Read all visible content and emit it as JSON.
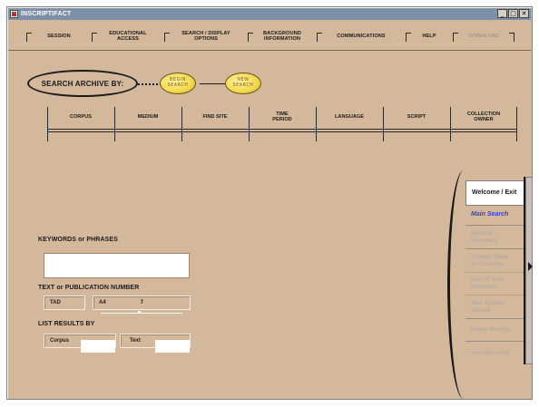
{
  "window": {
    "title": "INSCRIPTIFACT",
    "controls": [
      "_",
      "□",
      "✕"
    ]
  },
  "menu": [
    {
      "label": "SESSION",
      "enabled": true
    },
    {
      "label": "EDUCATIONAL\nACCESS",
      "enabled": true
    },
    {
      "label": "SEARCH / DISPLAY\nOPTIONS",
      "enabled": true
    },
    {
      "label": "BACKGROUND\nINFORMATION",
      "enabled": true
    },
    {
      "label": "COMMUNICATIONS",
      "enabled": true
    },
    {
      "label": "HELP",
      "enabled": true
    },
    {
      "label": "DOWNLOAD",
      "enabled": false
    }
  ],
  "search": {
    "archive_label": "SEARCH ARCHIVE BY:",
    "begin_button": "BEGIN\nSEARCH",
    "new_button": "NEW\nSEARCH"
  },
  "categories": [
    "CORPUS",
    "MEDIUM",
    "FIND SITE",
    "TIME\nPERIOD",
    "LANGUAGE",
    "SCRIPT",
    "COLLECTION\nOWNER"
  ],
  "keywords": {
    "label": "KEYWORDS or PHRASES",
    "value": ""
  },
  "publication": {
    "label": "TEXT or PUBLICATION NUMBER",
    "prefix": "TAD",
    "field_a": "A4",
    "field_b": "7"
  },
  "list_results": {
    "label": "LIST RESULTS BY",
    "corpus": "Corpus",
    "text": "Text"
  },
  "nav": [
    {
      "label": "Welcome / Exit",
      "state": "active"
    },
    {
      "label": "Main Search",
      "state": "current"
    },
    {
      "label": "Results\nSummary",
      "state": "disabled"
    },
    {
      "label": "Corpus Table\nof Contents",
      "state": "disabled"
    },
    {
      "label": "List Of Text\nDivisions",
      "state": "disabled"
    },
    {
      "label": "Text Spatial\nSearch",
      "state": "disabled"
    },
    {
      "label": "Image Results",
      "state": "disabled"
    },
    {
      "label": "View/DeskTop",
      "state": "disabled"
    }
  ],
  "colors": {
    "background": "#d4b89c",
    "titlebar": "#7d90a8",
    "current_link": "#3840c8",
    "button_yellow": "#f2d84b"
  }
}
